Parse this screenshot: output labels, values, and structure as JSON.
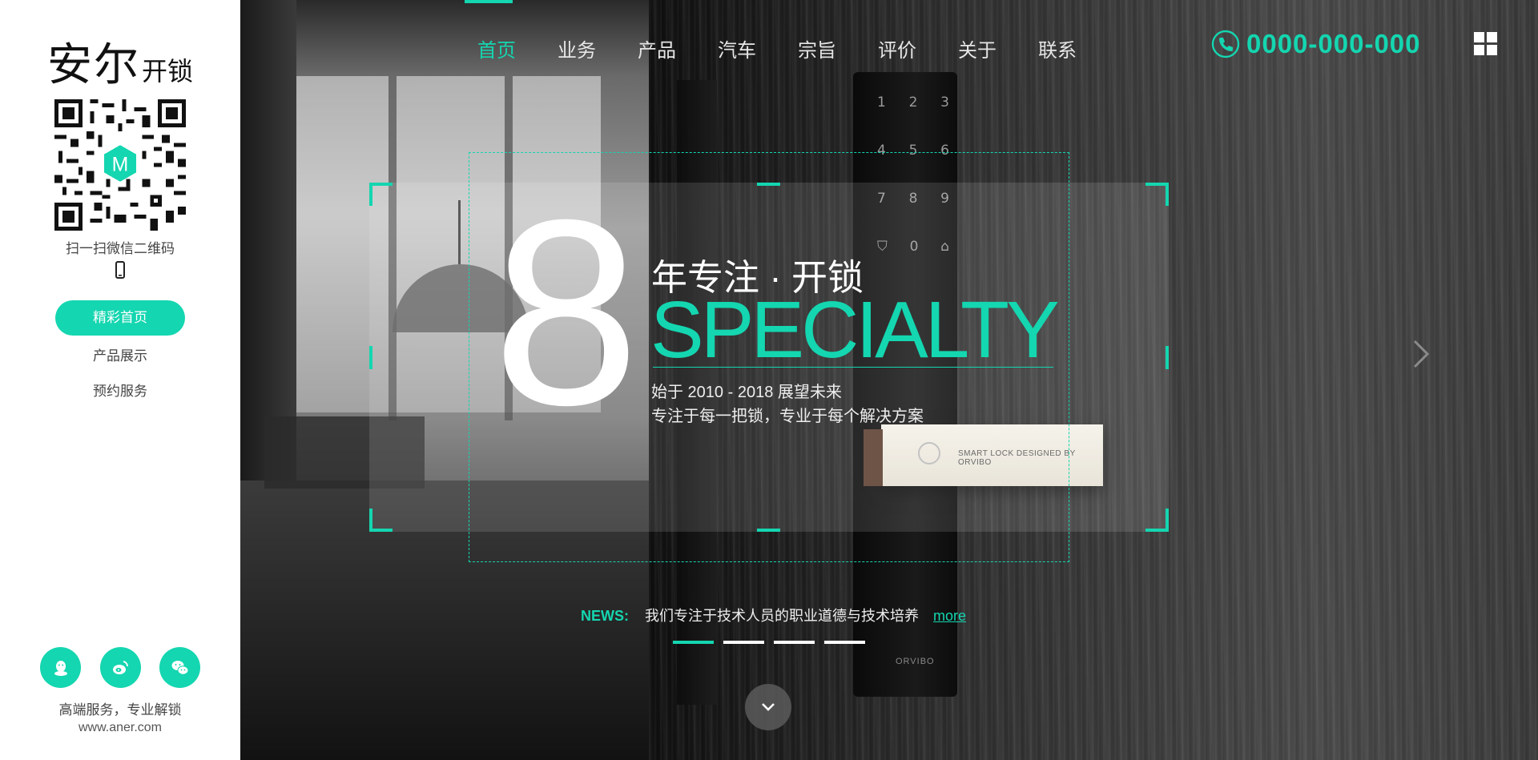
{
  "brand": {
    "logo_main": "安尔",
    "logo_sub": "开锁",
    "qr_caption": "扫一扫微信二维码",
    "slogan": "高端服务，专业解锁",
    "url": "www.aner.com",
    "accent_color": "#14d6b0"
  },
  "sidebar": {
    "nav": [
      {
        "label": "精彩首页",
        "active": true
      },
      {
        "label": "产品展示",
        "active": false
      },
      {
        "label": "预约服务",
        "active": false
      }
    ],
    "social_icons": [
      "qq-icon",
      "weibo-icon",
      "wechat-icon"
    ]
  },
  "topnav": {
    "items": [
      {
        "label": "首页",
        "active": true
      },
      {
        "label": "业务",
        "active": false
      },
      {
        "label": "产品",
        "active": false
      },
      {
        "label": "汽车",
        "active": false
      },
      {
        "label": "宗旨",
        "active": false
      },
      {
        "label": "评价",
        "active": false
      },
      {
        "label": "关于",
        "active": false
      },
      {
        "label": "联系",
        "active": false
      }
    ],
    "phone": "0000-000-000"
  },
  "hero": {
    "big_number": "8",
    "tagline": "年专注 · 开锁",
    "headline": "SPECIALTY",
    "line1": "始于 2010 - 2018 展望未来",
    "line2": "专注于每一把锁，专业于每个解决方案",
    "keypad": [
      [
        "1",
        "2",
        "3"
      ],
      [
        "4",
        "5",
        "6"
      ],
      [
        "7",
        "8",
        "9"
      ],
      [
        "⛉",
        "0",
        "⌂"
      ]
    ],
    "card_text": "SMART LOCK DESIGNED BY ORVIBO",
    "lock_brand": "ORVIBO"
  },
  "news": {
    "label": "NEWS:",
    "text": "我们专注于技术人员的职业道德与技术培养",
    "more": "more"
  },
  "slider": {
    "count": 4,
    "active_index": 0
  }
}
